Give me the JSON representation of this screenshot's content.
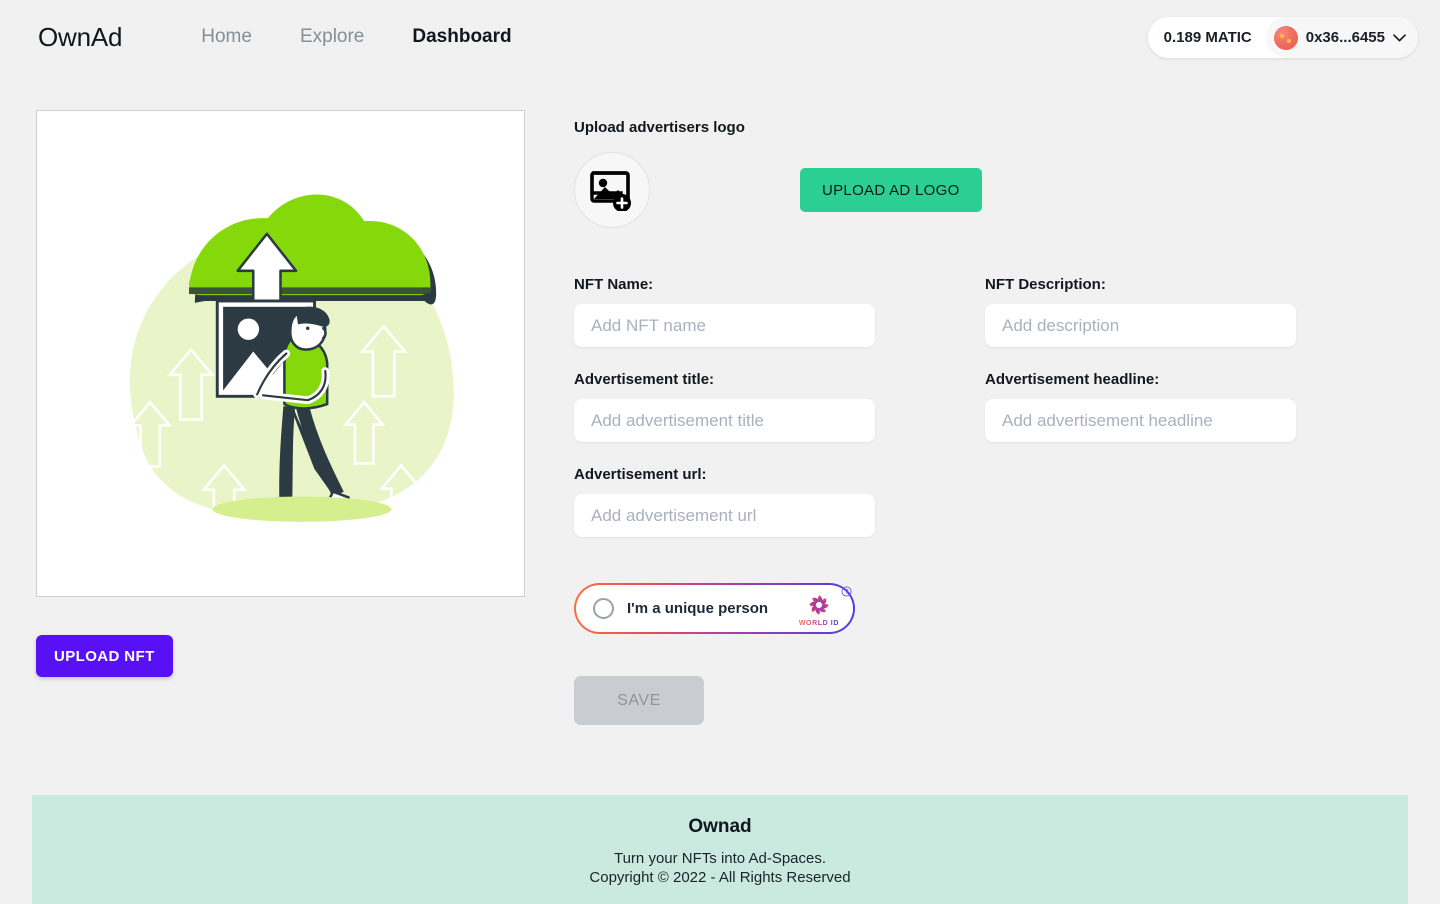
{
  "header": {
    "brand": "OwnAd",
    "nav": [
      {
        "label": "Home",
        "active": false
      },
      {
        "label": "Explore",
        "active": false
      },
      {
        "label": "Dashboard",
        "active": true
      }
    ],
    "wallet": {
      "balance": "0.189 MATIC",
      "address": "0x36...6455",
      "avatar_icon": "jazzicon-avatar",
      "chevron_icon": "chevron-down-icon"
    }
  },
  "preview": {
    "illustration_icon": "upload-image-illustration",
    "upload_nft_label": "UPLOAD NFT"
  },
  "logo_upload": {
    "label": "Upload advertisers logo",
    "drop_icon": "add-image-icon",
    "button_label": "UPLOAD AD LOGO"
  },
  "form": {
    "fields": [
      {
        "label": "NFT Name:",
        "placeholder": "Add NFT name",
        "value": "",
        "name": "nft-name"
      },
      {
        "label": "NFT Description:",
        "placeholder": "Add description",
        "value": "",
        "name": "nft-description"
      },
      {
        "label": "Advertisement title:",
        "placeholder": "Add advertisement title",
        "value": "",
        "name": "advertisement-title"
      },
      {
        "label": "Advertisement headline:",
        "placeholder": "Add advertisement headline",
        "value": "",
        "name": "advertisement-headline"
      },
      {
        "label": "Advertisement url:",
        "placeholder": "Add advertisement url",
        "value": "",
        "name": "advertisement-url"
      }
    ],
    "world_id": {
      "checkbox_label": "I'm a unique person",
      "brand_label": "WORLD ID",
      "checked": false,
      "help_icon": "question-mark-icon",
      "logo_icon": "world-id-logo-icon"
    },
    "save_label": "SAVE",
    "save_disabled": true
  },
  "footer": {
    "title": "Ownad",
    "tagline": "Turn your NFTs into Ad-Spaces.",
    "copyright": "Copyright © 2022 - All Rights Reserved"
  },
  "colors": {
    "page_bg": "#f1f1f1",
    "accent_green": "#2bcf93",
    "accent_purple": "#5811f4",
    "footer_bg": "#cbeadf",
    "worldid_gradient_start": "#ff6c3e",
    "worldid_gradient_end": "#4940e0"
  }
}
